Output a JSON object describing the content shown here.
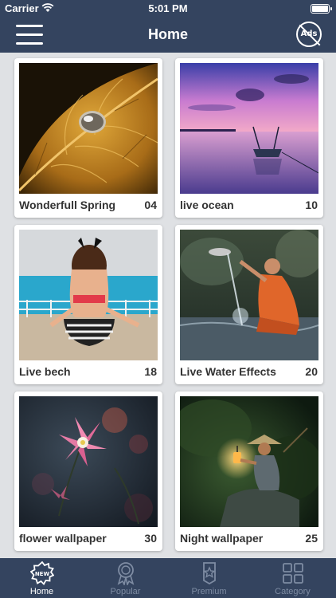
{
  "status_bar": {
    "carrier": "Carrier",
    "time": "5:01 PM"
  },
  "nav": {
    "title": "Home",
    "ads_icon_text": "Ads"
  },
  "categories": [
    {
      "name": "Wonderfull Spring",
      "count": "04"
    },
    {
      "name": "live ocean",
      "count": "10"
    },
    {
      "name": "Live bech",
      "count": "18"
    },
    {
      "name": "Live Water Effects",
      "count": "20"
    },
    {
      "name": "flower wallpaper",
      "count": "30"
    },
    {
      "name": "Night wallpaper",
      "count": "25"
    }
  ],
  "tabs": [
    {
      "label": "Home",
      "icon": "new-badge-icon",
      "active": true
    },
    {
      "label": "Popular",
      "icon": "award-ribbon-icon",
      "active": false
    },
    {
      "label": "Premium",
      "icon": "premium-badge-icon",
      "active": false
    },
    {
      "label": "Category",
      "icon": "grid-icon",
      "active": false
    }
  ],
  "colors": {
    "bar_background": "#34445f",
    "page_background": "#dfe1e4",
    "active_tab": "#ffffff",
    "inactive_tab": "#7e8ca3"
  }
}
